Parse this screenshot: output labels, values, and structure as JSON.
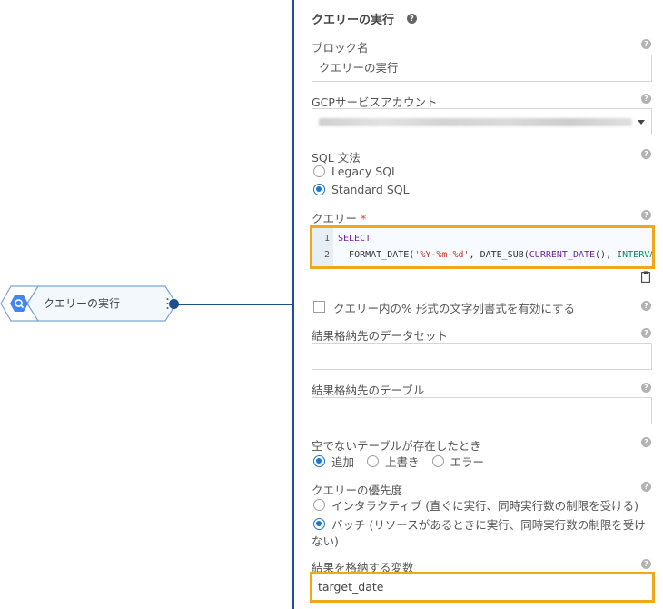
{
  "canvas": {
    "node_label": "クエリーの実行"
  },
  "panel": {
    "title": "クエリーの実行",
    "block_name": {
      "label": "ブロック名",
      "value": "クエリーの実行"
    },
    "gcp_account": {
      "label": "GCPサービスアカウント"
    },
    "sql_syntax": {
      "label": "SQL 文法",
      "options": [
        "Legacy SQL",
        "Standard SQL"
      ],
      "selected": "Standard SQL"
    },
    "query": {
      "label": "クエリー",
      "required_mark": "*",
      "lines": [
        {
          "number": "1",
          "keyword": "SELECT"
        },
        {
          "number": "2",
          "indent": "  ",
          "fn1": "FORMAT_DATE",
          "p1": "(",
          "str": "'%Y-%m-%d'",
          "sep": ", ",
          "fn2": "DATE_SUB",
          "p2": "(",
          "fn3": "CURRENT_DATE",
          "p3": "(), ",
          "tail": "INTERVA"
        }
      ]
    },
    "format_option": {
      "label": "クエリー内の% 形式の文字列書式を有効にする",
      "checked": false
    },
    "dest_dataset": {
      "label": "結果格納先のデータセット",
      "value": ""
    },
    "dest_table": {
      "label": "結果格納先のテーブル",
      "value": ""
    },
    "non_empty_table": {
      "label": "空でないテーブルが存在したとき",
      "options": [
        "追加",
        "上書き",
        "エラー"
      ],
      "selected": "追加"
    },
    "priority": {
      "label": "クエリーの優先度",
      "options": [
        "インタラクティブ (直ぐに実行、同時実行数の制限を受ける)",
        "バッチ (リソースがあるときに実行、同時実行数の制限を受け",
        "ない)"
      ],
      "selected": "バッチ"
    },
    "result_variable": {
      "label": "結果を格納する変数",
      "value": "target_date"
    }
  },
  "colors": {
    "accent": "#1976d2",
    "divider": "#1e4e8c",
    "highlight": "#f0a71a"
  }
}
